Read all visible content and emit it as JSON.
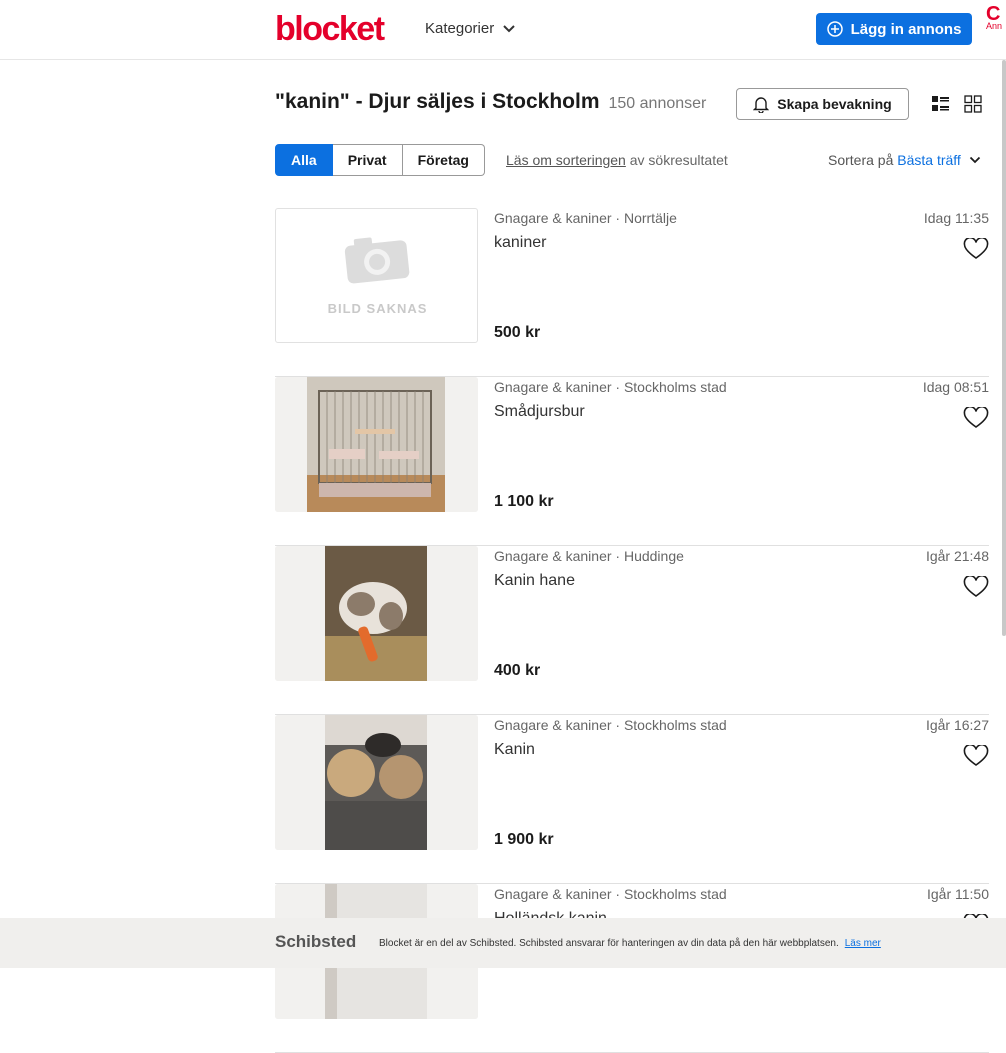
{
  "header": {
    "logo": "blocket",
    "categories_label": "Kategorier",
    "post_ad_label": "Lägg in annons",
    "corner_letter": "C",
    "corner_text": "Ann"
  },
  "search": {
    "title": "\"kanin\" - Djur säljes i Stockholm",
    "count": "150 annonser",
    "watch_label": "Skapa bevakning",
    "filters": [
      "Alla",
      "Privat",
      "Företag"
    ],
    "sort_info_link": "Läs om sorteringen",
    "sort_info_rest": " av sökresultatet",
    "sort_label": "Sortera på",
    "sort_value": "Bästa träff"
  },
  "listings": [
    {
      "meta": "Gnagare & kaniner · Norrtälje",
      "title": "kaniner",
      "price": "500 kr",
      "time": "Idag 11:35",
      "image": "none",
      "missing_label": "BILD SAKNAS"
    },
    {
      "meta": "Gnagare & kaniner · Stockholms stad",
      "title": "Smådjursbur",
      "price": "1 100 kr",
      "time": "Idag 08:51",
      "image": "cage"
    },
    {
      "meta": "Gnagare & kaniner · Huddinge",
      "title": "Kanin hane",
      "price": "400 kr",
      "time": "Igår 21:48",
      "image": "rabbit"
    },
    {
      "meta": "Gnagare & kaniner · Stockholms stad",
      "title": "Kanin",
      "price": "1 900 kr",
      "time": "Igår 16:27",
      "image": "rabbits"
    },
    {
      "meta": "Gnagare & kaniner · Stockholms stad",
      "title": "Holländsk kanin",
      "price": "",
      "time": "Igår 11:50",
      "image": "wall"
    }
  ],
  "footer": {
    "brand": "Schibsted",
    "text": "Blocket är en del av Schibsted. Schibsted ansvarar för hanteringen av din data på den här webbplatsen.",
    "link": "Läs mer"
  },
  "colors": {
    "brand_red": "#e4002b",
    "accent_blue": "#0c70e0"
  }
}
